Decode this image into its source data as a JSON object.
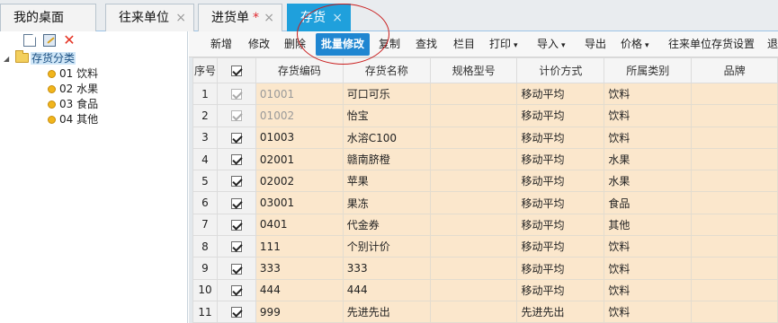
{
  "tabs": [
    {
      "label": "我的桌面",
      "closable": false,
      "modified": false,
      "active": false
    },
    {
      "label": "往来单位",
      "closable": true,
      "modified": false,
      "active": false
    },
    {
      "label": "进货单",
      "closable": true,
      "modified": true,
      "active": false
    },
    {
      "label": "存货",
      "closable": true,
      "modified": false,
      "active": true
    }
  ],
  "tab_close_glyph": "×",
  "tab_modified_glyph": "*",
  "left_toolbar": {
    "icons": [
      "new-document-icon",
      "edit-icon",
      "delete-icon"
    ],
    "delete_glyph": "✕"
  },
  "tree": {
    "root": "存货分类",
    "items": [
      "01 饮料",
      "02 水果",
      "03 食品",
      "04 其他"
    ]
  },
  "toolbar": {
    "items": [
      {
        "label": "新增",
        "dropdown": false
      },
      {
        "label": "修改",
        "dropdown": false
      },
      {
        "label": "删除",
        "dropdown": false
      },
      {
        "label": "批量修改",
        "dropdown": false,
        "active": true
      },
      {
        "label": "复制",
        "dropdown": false
      },
      {
        "label": "查找",
        "dropdown": false
      },
      {
        "label": "栏目",
        "dropdown": false
      },
      {
        "label": "打印",
        "dropdown": true
      },
      {
        "label": "导入",
        "dropdown": true
      },
      {
        "label": "导出",
        "dropdown": false
      },
      {
        "label": "价格",
        "dropdown": true
      },
      {
        "label": "往来单位存货设置",
        "dropdown": false
      },
      {
        "label": "退",
        "dropdown": false
      }
    ],
    "caret_glyph": "▾"
  },
  "grid": {
    "columns": [
      "序号",
      "",
      "存货编码",
      "存货名称",
      "规格型号",
      "计价方式",
      "所属类别",
      "品牌"
    ],
    "header_checkbox_checked": true,
    "rows": [
      {
        "no": "1",
        "checked": true,
        "disabled": true,
        "code": "01001",
        "name": "可口可乐",
        "spec": "",
        "pricing": "移动平均",
        "category": "饮料",
        "brand": ""
      },
      {
        "no": "2",
        "checked": true,
        "disabled": true,
        "code": "01002",
        "name": "怡宝",
        "spec": "",
        "pricing": "移动平均",
        "category": "饮料",
        "brand": ""
      },
      {
        "no": "3",
        "checked": true,
        "disabled": false,
        "code": "01003",
        "name": "水溶C100",
        "spec": "",
        "pricing": "移动平均",
        "category": "饮料",
        "brand": ""
      },
      {
        "no": "4",
        "checked": true,
        "disabled": false,
        "code": "02001",
        "name": "赣南脐橙",
        "spec": "",
        "pricing": "移动平均",
        "category": "水果",
        "brand": ""
      },
      {
        "no": "5",
        "checked": true,
        "disabled": false,
        "code": "02002",
        "name": "苹果",
        "spec": "",
        "pricing": "移动平均",
        "category": "水果",
        "brand": ""
      },
      {
        "no": "6",
        "checked": true,
        "disabled": false,
        "code": "03001",
        "name": "果冻",
        "spec": "",
        "pricing": "移动平均",
        "category": "食品",
        "brand": ""
      },
      {
        "no": "7",
        "checked": true,
        "disabled": false,
        "code": "0401",
        "name": "代金券",
        "spec": "",
        "pricing": "移动平均",
        "category": "其他",
        "brand": ""
      },
      {
        "no": "8",
        "checked": true,
        "disabled": false,
        "code": "111",
        "name": "个别计价",
        "spec": "",
        "pricing": "移动平均",
        "category": "饮料",
        "brand": ""
      },
      {
        "no": "9",
        "checked": true,
        "disabled": false,
        "code": "333",
        "name": "333",
        "spec": "",
        "pricing": "移动平均",
        "category": "饮料",
        "brand": ""
      },
      {
        "no": "10",
        "checked": true,
        "disabled": false,
        "code": "444",
        "name": "444",
        "spec": "",
        "pricing": "移动平均",
        "category": "饮料",
        "brand": ""
      },
      {
        "no": "11",
        "checked": true,
        "disabled": false,
        "code": "999",
        "name": "先进先出",
        "spec": "",
        "pricing": "先进先出",
        "category": "饮料",
        "brand": ""
      }
    ]
  },
  "colors": {
    "active_tab": "#1fa0dc",
    "active_button": "#1f86d1",
    "row_highlight": "#fbe7cc",
    "annotation_ring": "#c91d1d"
  }
}
